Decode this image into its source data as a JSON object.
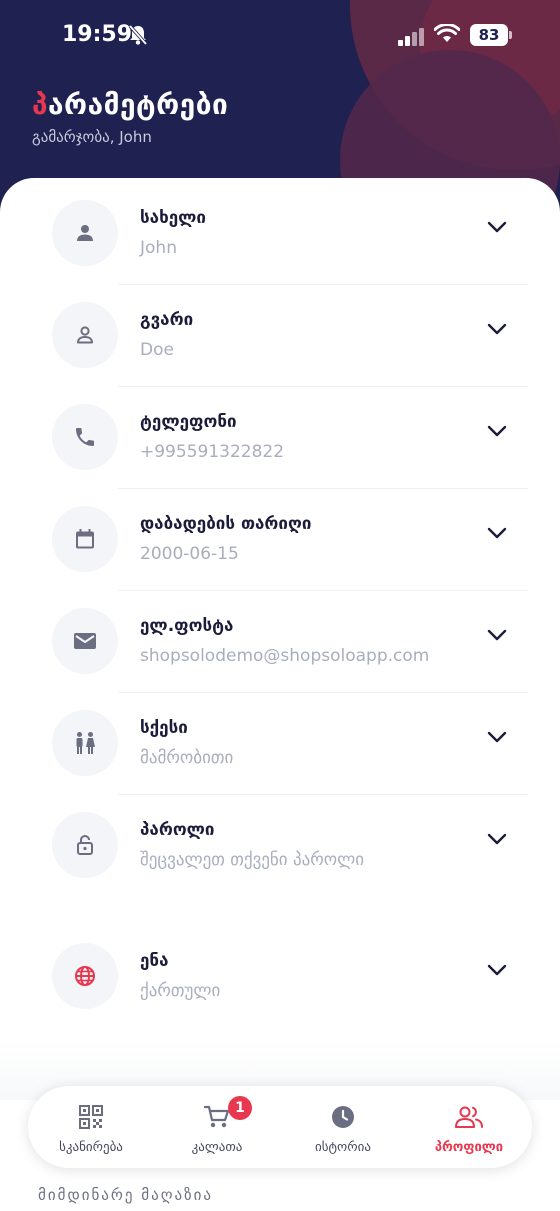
{
  "status_bar": {
    "time": "19:59",
    "battery": "83"
  },
  "header": {
    "title_first_letter": "პ",
    "title_rest": "არამეტრები",
    "greeting": "გამარჯობა, John"
  },
  "fields": [
    {
      "label": "სახელი",
      "value": "John",
      "icon": "person-icon"
    },
    {
      "label": "გვარი",
      "value": "Doe",
      "icon": "person-outline-icon"
    },
    {
      "label": "ტელეფონი",
      "value": "+995591322822",
      "icon": "phone-icon"
    },
    {
      "label": "დაბადების თარიღი",
      "value": "2000-06-15",
      "icon": "calendar-icon"
    },
    {
      "label": "ელ.ფოსტა",
      "value": "shopsolodemo@shopsoloapp.com",
      "icon": "mail-icon"
    },
    {
      "label": "სქესი",
      "value": "მამრობითი",
      "icon": "gender-icon"
    },
    {
      "label": "პაროლი",
      "value": "შეცვალეთ თქვენი პაროლი",
      "icon": "lock-icon"
    },
    {
      "label": "ენა",
      "value": "ქართული",
      "icon": "globe-icon"
    }
  ],
  "tabbar": {
    "tabs": [
      {
        "label": "სკანირება",
        "icon": "qr-code-icon"
      },
      {
        "label": "კალათა",
        "icon": "cart-icon",
        "badge": "1"
      },
      {
        "label": "ისტორია",
        "icon": "clock-icon"
      },
      {
        "label": "პროფილი",
        "icon": "people-icon",
        "active": true
      }
    ]
  },
  "footer": {
    "current_store": "მიმდინარე მაღაზია"
  },
  "colors": {
    "header_bg": "#1f2150",
    "accent": "#e8384f",
    "label": "#1b1c3a",
    "muted": "#a9adbd"
  }
}
